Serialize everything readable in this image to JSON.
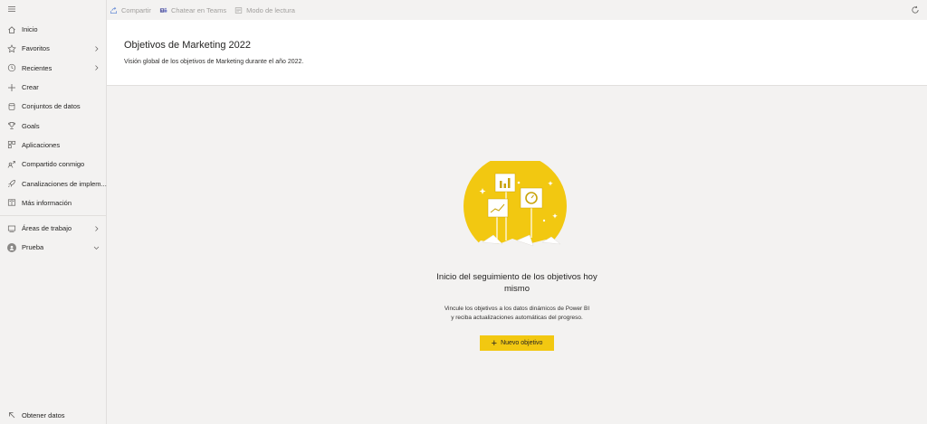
{
  "sidebar": {
    "items": [
      {
        "label": "Inicio",
        "icon": "home-icon"
      },
      {
        "label": "Favoritos",
        "icon": "star-icon",
        "chevron": "right"
      },
      {
        "label": "Recientes",
        "icon": "clock-icon",
        "chevron": "right"
      },
      {
        "label": "Crear",
        "icon": "plus-icon"
      },
      {
        "label": "Conjuntos de datos",
        "icon": "database-icon"
      },
      {
        "label": "Goals",
        "icon": "trophy-icon"
      },
      {
        "label": "Aplicaciones",
        "icon": "apps-icon"
      },
      {
        "label": "Compartido conmigo",
        "icon": "shared-icon"
      },
      {
        "label": "Canalizaciones de implem...",
        "icon": "rocket-icon"
      },
      {
        "label": "Más información",
        "icon": "book-icon"
      }
    ],
    "workspaces": {
      "label": "Áreas de trabajo",
      "icon": "workspaces-icon"
    },
    "current_workspace": {
      "label": "Prueba",
      "icon": "workspace-avatar-icon"
    },
    "bottom": {
      "label": "Obtener datos",
      "icon": "arrow-upleft-icon"
    }
  },
  "toolbar": {
    "share": "Compartir",
    "teams": "Chatear en Teams",
    "reading": "Modo de lectura"
  },
  "header": {
    "title": "Objetivos de Marketing 2022",
    "subtitle": "Visión global de los objetivos de Marketing durante el año 2022."
  },
  "empty_state": {
    "title": "Inicio del seguimiento de los objetivos hoy mismo",
    "desc_line1": "Vincule los objetivos a los datos dinámicos de Power BI",
    "desc_line2": "y reciba actualizaciones automáticas del progreso.",
    "button": "Nuevo objetivo"
  },
  "colors": {
    "accent": "#f2c811",
    "icon": "#605e5c",
    "muted": "#a19f9d"
  }
}
